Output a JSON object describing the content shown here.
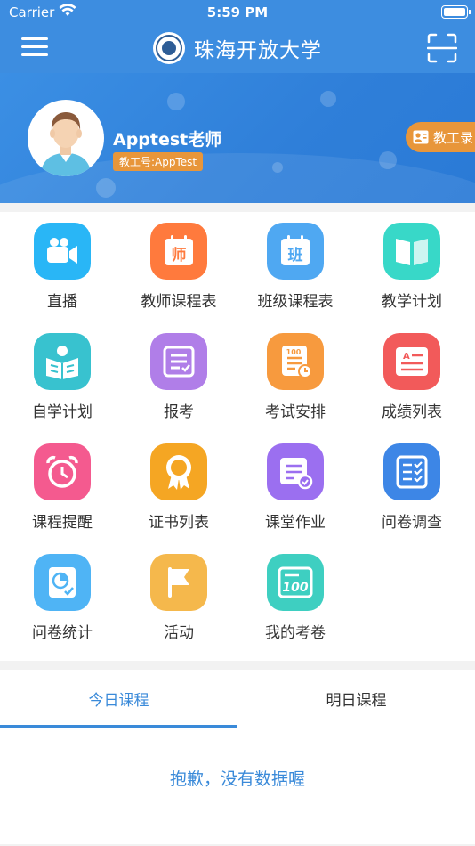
{
  "status": {
    "carrier": "Carrier",
    "time": "5:59 PM"
  },
  "header": {
    "title": "珠海开放大学"
  },
  "profile": {
    "name": "Apptest老师",
    "id_label": "教工号:AppTest",
    "directory_button": "教工录"
  },
  "grid": [
    {
      "label": "直播",
      "icon": "live-video-icon",
      "color": "#29b6f6"
    },
    {
      "label": "教师课程表",
      "icon": "teacher-timetable-icon",
      "color": "#ff7a3d"
    },
    {
      "label": "班级课程表",
      "icon": "class-timetable-icon",
      "color": "#4fa8f2"
    },
    {
      "label": "教学计划",
      "icon": "open-book-icon",
      "color": "#38d8c8"
    },
    {
      "label": "自学计划",
      "icon": "self-study-icon",
      "color": "#38c2cf"
    },
    {
      "label": "报考",
      "icon": "registration-icon",
      "color": "#b07ee8"
    },
    {
      "label": "考试安排",
      "icon": "exam-schedule-icon",
      "color": "#f79a3e"
    },
    {
      "label": "成绩列表",
      "icon": "grade-list-icon",
      "color": "#f25a5a"
    },
    {
      "label": "课程提醒",
      "icon": "alarm-clock-icon",
      "color": "#f45a8f"
    },
    {
      "label": "证书列表",
      "icon": "certificate-medal-icon",
      "color": "#f5a623"
    },
    {
      "label": "课堂作业",
      "icon": "homework-icon",
      "color": "#9b6ff0"
    },
    {
      "label": "问卷调查",
      "icon": "survey-checklist-icon",
      "color": "#3d86e6"
    },
    {
      "label": "问卷统计",
      "icon": "survey-stats-icon",
      "color": "#4fb4f5"
    },
    {
      "label": "活动",
      "icon": "flag-icon",
      "color": "#f5b84c"
    },
    {
      "label": "我的考卷",
      "icon": "exam-paper-icon",
      "color": "#3ecfc1"
    }
  ],
  "tabs": [
    {
      "label": "今日课程"
    },
    {
      "label": "明日课程"
    }
  ],
  "empty_message": "抱歉，没有数据喔",
  "icon_glyphs": {
    "teacher": "师",
    "class": "班"
  }
}
